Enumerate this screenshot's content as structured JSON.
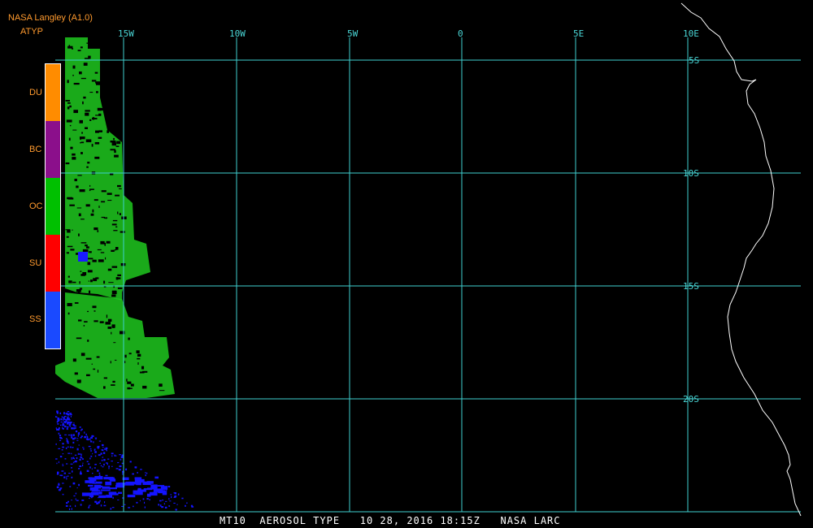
{
  "header": {
    "source": "NASA Langley (A1.0)",
    "product": "ATYP"
  },
  "legend": [
    {
      "code": "DU",
      "color": "#ff8c00"
    },
    {
      "code": "BC",
      "color": "#8b0f8b"
    },
    {
      "code": "OC",
      "color": "#00c000"
    },
    {
      "code": "SU",
      "color": "#ff0000"
    },
    {
      "code": "SS",
      "color": "#1a4aff"
    }
  ],
  "grid": {
    "longitude_labels": [
      "15W",
      "10W",
      "5W",
      "0",
      "5E",
      "10E"
    ],
    "latitude_labels": [
      "5S",
      "10S",
      "15S",
      "20S"
    ],
    "line_color": "#3fd0d0"
  },
  "footer": {
    "satellite": "MT10",
    "title": "AEROSOL TYPE",
    "datetime": "10 28, 2016 18:15Z",
    "credit": "NASA LARC"
  }
}
